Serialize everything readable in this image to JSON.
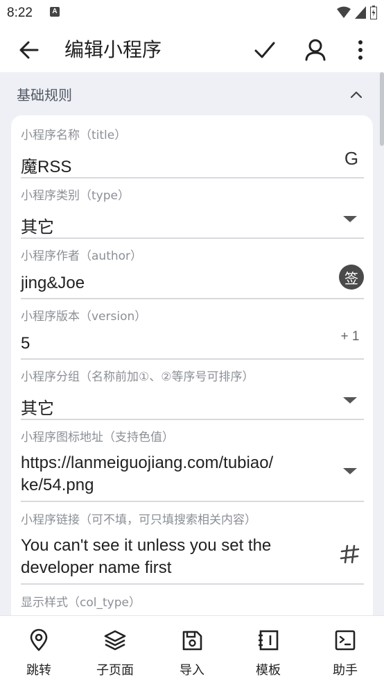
{
  "status_bar": {
    "time": "8:22",
    "notification": "A"
  },
  "app_bar": {
    "title": "编辑小程序",
    "back_icon": "arrow-left-icon",
    "confirm_icon": "check-icon",
    "account_icon": "person-icon",
    "more_icon": "more-vert-icon"
  },
  "section": {
    "title": "基础规则",
    "expanded": true
  },
  "fields": {
    "title": {
      "label": "小程序名称（title）",
      "value": "魔RSS",
      "action": "G"
    },
    "type": {
      "label": "小程序类别（type）",
      "value": "其它"
    },
    "author": {
      "label": "小程序作者（author）",
      "value": "jing&Joe",
      "action": "签"
    },
    "version": {
      "label": "小程序版本（version）",
      "value": "5",
      "action": "+ 1"
    },
    "group": {
      "label": "小程序分组（名称前加①、②等序号可排序）",
      "value": "其它"
    },
    "icon_url": {
      "label": "小程序图标地址（支持色值）",
      "value": "https://lanmeiguojiang.com/tubiao/ke/54.png"
    },
    "link": {
      "label": "小程序链接（可不填，可只填搜索相关内容）",
      "value": "You can't see it unless you set the developer name first",
      "action_icon": "hash-icon"
    },
    "col_type": {
      "label": "显示样式（col_type）"
    }
  },
  "bottom_nav": [
    {
      "label": "跳转",
      "icon": "location-pin-icon"
    },
    {
      "label": "子页面",
      "icon": "layers-icon"
    },
    {
      "label": "导入",
      "icon": "save-icon"
    },
    {
      "label": "模板",
      "icon": "notebook-icon"
    },
    {
      "label": "助手",
      "icon": "terminal-icon"
    }
  ],
  "colors": {
    "background": "#eef0f5",
    "card": "#ffffff",
    "label": "#8b8f96",
    "divider": "#d7d9dd"
  }
}
